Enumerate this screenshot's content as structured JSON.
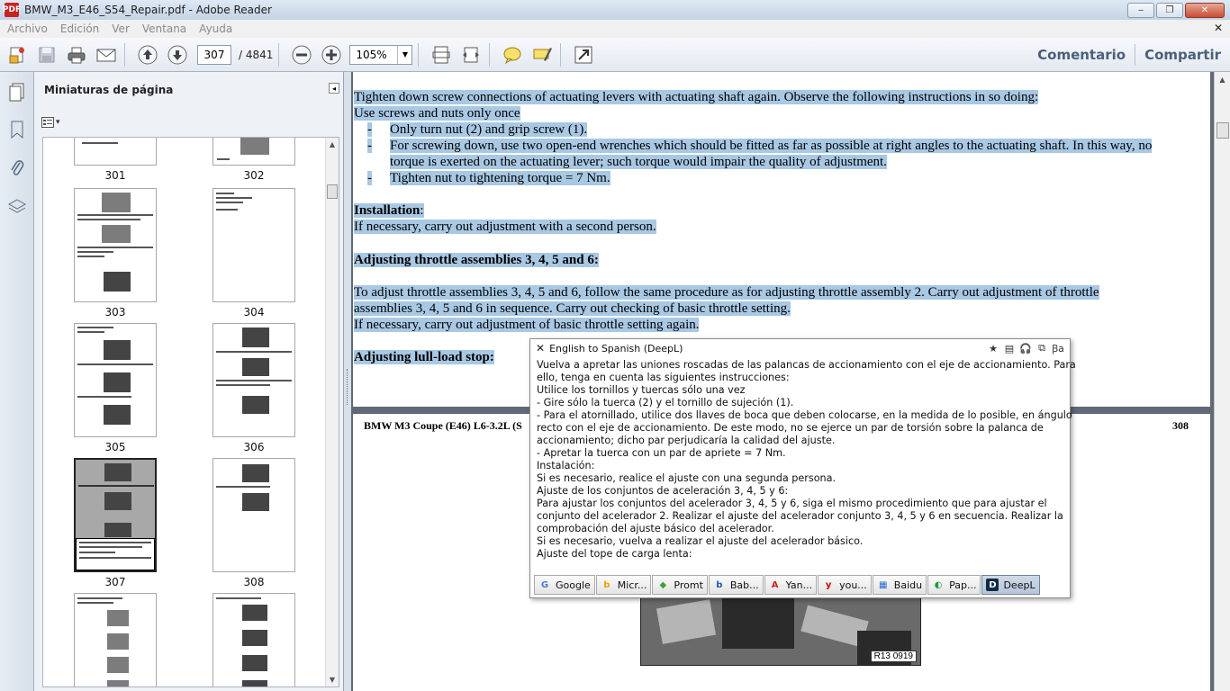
{
  "window": {
    "app_icon": "PDF",
    "title": "BMW_M3_E46_S54_Repair.pdf - Adobe Reader",
    "controls": [
      "‒",
      "❐",
      "✕"
    ]
  },
  "menu": {
    "items": [
      "Archivo",
      "Edición",
      "Ver",
      "Ventana",
      "Ayuda"
    ],
    "close": "✕"
  },
  "toolbar": {
    "page_current": "307",
    "page_total": "/ 4841",
    "zoom": "105%",
    "zoom_arrow": "▼",
    "comment": "Comentario",
    "share": "Compartir"
  },
  "panel": {
    "title": "Miniaturas de página",
    "collapse": "◂",
    "options": "▾",
    "thumbnails": [
      {
        "label": "301"
      },
      {
        "label": "302"
      },
      {
        "label": "303"
      },
      {
        "label": "304"
      },
      {
        "label": "305"
      },
      {
        "label": "306"
      },
      {
        "label": "307",
        "selected": true
      },
      {
        "label": "308"
      },
      {
        "label": ""
      },
      {
        "label": ""
      }
    ],
    "scroll_up": "▲",
    "scroll_down": "▼"
  },
  "document": {
    "page307": {
      "lines": [
        "Tighten down screw connections of actuating levers with actuating shaft again. Observe the following instructions in so doing:",
        "Use screws and nuts only once",
        "Only turn nut (2) and grip screw (1).",
        "For screwing down, use two open-end wrenches which should be fitted as far as possible at right angles to the actuating shaft. In this way, no",
        "torque is exerted on the actuating lever; such torque would impair the quality of adjustment.",
        "Tighten nut to tightening torque = 7 Nm.",
        "Installation",
        "If necessary, carry out adjustment with a second person.",
        "Adjusting throttle assemblies 3, 4, 5 and 6:",
        "To adjust throttle assemblies 3, 4, 5 and 6, follow the same procedure as for adjusting throttle assembly 2. Carry out adjustment of throttle",
        "assemblies 3, 4, 5 and 6 in sequence. Carry out checking of basic throttle setting.",
        "If necessary, carry out adjustment of basic throttle setting again.",
        "Adjusting lull-load stop:"
      ],
      "dash": "-",
      "colon": ":"
    },
    "page308": {
      "header": "BMW M3 Coupe (E46) L6-3.2L (S",
      "page_number": "308",
      "figure_label": "R13 0919"
    }
  },
  "popup": {
    "close": "✕",
    "title": "English to Spanish (DeepL)",
    "tools": [
      "★",
      "▤",
      "🎧",
      "⧉",
      "Ꞵa"
    ],
    "lines": [
      "Vuelva a apretar las uniones roscadas de las palancas de accionamiento con el eje de accionamiento. Para",
      "ello, tenga en cuenta las siguientes instrucciones:",
      "Utilice los tornillos y tuercas sólo una vez",
      "- Gire sólo la tuerca (2) y el tornillo de sujeción (1).",
      "- Para el atornillado, utilice dos llaves de boca que deben colocarse, en la medida de lo posible, en ángulo",
      "recto con el eje de accionamiento. De este modo, no se ejerce un par de torsión sobre la palanca de",
      "accionamiento; dicho par perjudicaría la calidad del ajuste.",
      "- Apretar la tuerca con un par de apriete = 7 Nm.",
      "Instalación:",
      "Si es necesario, realice el ajuste con una segunda persona.",
      "Ajuste de los conjuntos de aceleración 3, 4, 5 y 6:",
      "Para ajustar los conjuntos del acelerador 3, 4, 5 y 6, siga el mismo procedimiento que para ajustar el",
      "conjunto del acelerador 2. Realizar el ajuste del acelerador conjunto 3, 4, 5 y 6 en secuencia. Realizar la",
      "comprobación del ajuste básico del acelerador.",
      "Si es necesario, vuelva a realizar el ajuste del acelerador básico.",
      "Ajuste del tope de carga lenta:"
    ],
    "engines": [
      {
        "label": "Google",
        "icon": "G",
        "color": "#4a7fd8"
      },
      {
        "label": "Micr...",
        "icon": "b",
        "color": "#f2a000"
      },
      {
        "label": "Promt",
        "icon": "◆",
        "color": "#3ba33b"
      },
      {
        "label": "Bab...",
        "icon": "b",
        "color": "#1f5bb5"
      },
      {
        "label": "Yan...",
        "icon": "A",
        "color": "#cc2222"
      },
      {
        "label": "you...",
        "icon": "y",
        "color": "#cc0000"
      },
      {
        "label": "Baidu",
        "icon": "▦",
        "color": "#2a6bd1"
      },
      {
        "label": "Pap...",
        "icon": "◐",
        "color": "#1c9a3a"
      },
      {
        "label": "DeepL",
        "icon": "D",
        "color": "#0f2b46",
        "active": true
      }
    ]
  }
}
